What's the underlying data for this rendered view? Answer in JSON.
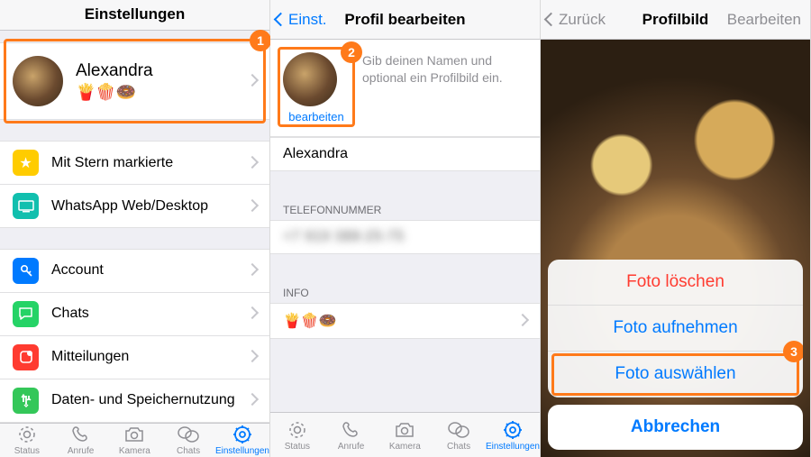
{
  "colors": {
    "accent": "#007aff",
    "callout": "#ff7a1a",
    "destructive": "#ff3b30"
  },
  "screen1": {
    "title": "Einstellungen",
    "profile": {
      "name": "Alexandra",
      "status": "🍟🍿🍩"
    },
    "group2": [
      {
        "icon": "star-icon",
        "label": "Mit Stern markierte"
      },
      {
        "icon": "desktop-icon",
        "label": "WhatsApp Web/Desktop"
      }
    ],
    "group3": [
      {
        "icon": "key-icon",
        "label": "Account"
      },
      {
        "icon": "chat-icon",
        "label": "Chats"
      },
      {
        "icon": "notification-icon",
        "label": "Mitteilungen"
      },
      {
        "icon": "data-icon",
        "label": "Daten- und Speichernutzung"
      }
    ],
    "badge": "1"
  },
  "screen2": {
    "back": "Einst.",
    "title": "Profil bearbeiten",
    "edit_link": "bearbeiten",
    "hint": "Gib deinen Namen und optional ein Profilbild ein.",
    "name_value": "Alexandra",
    "phone_header": "TELEFONNUMMER",
    "phone_value": "+7 919 388-25-75",
    "info_header": "INFO",
    "info_value": "🍟🍿🍩",
    "badge": "2"
  },
  "tabs": [
    {
      "label": "Status"
    },
    {
      "label": "Anrufe"
    },
    {
      "label": "Kamera"
    },
    {
      "label": "Chats"
    },
    {
      "label": "Einstellungen"
    }
  ],
  "screen3": {
    "back": "Zurück",
    "title": "Profilbild",
    "right": "Bearbeiten",
    "options": [
      {
        "label": "Foto löschen",
        "destructive": true
      },
      {
        "label": "Foto aufnehmen",
        "destructive": false
      },
      {
        "label": "Foto auswählen",
        "destructive": false
      }
    ],
    "cancel": "Abbrechen",
    "badge": "3"
  }
}
